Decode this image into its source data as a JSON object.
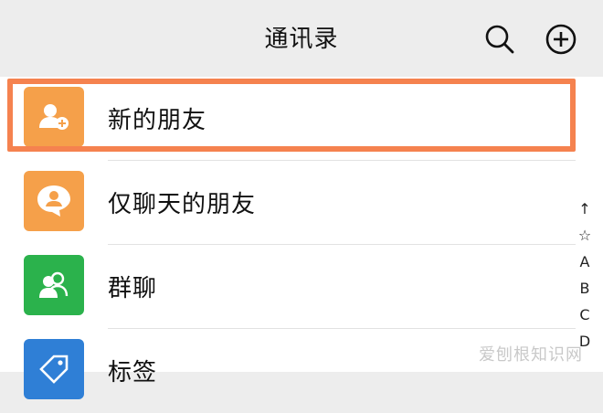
{
  "header": {
    "title": "通讯录",
    "search_icon": "search-icon",
    "add_icon": "plus-circle-icon"
  },
  "contacts": [
    {
      "label": "新的朋友",
      "icon": "person-add-icon",
      "color": "#f5a04a"
    },
    {
      "label": "仅聊天的朋友",
      "icon": "person-chat-icon",
      "color": "#f5a04a"
    },
    {
      "label": "群聊",
      "icon": "group-icon",
      "color": "#2bb24c"
    },
    {
      "label": "标签",
      "icon": "tag-icon",
      "color": "#2f7fd6"
    }
  ],
  "index_bar": [
    "↑",
    "☆",
    "A",
    "B",
    "C",
    "D"
  ],
  "highlight_color": "#f5824f",
  "watermark": "爱刨根知识网"
}
